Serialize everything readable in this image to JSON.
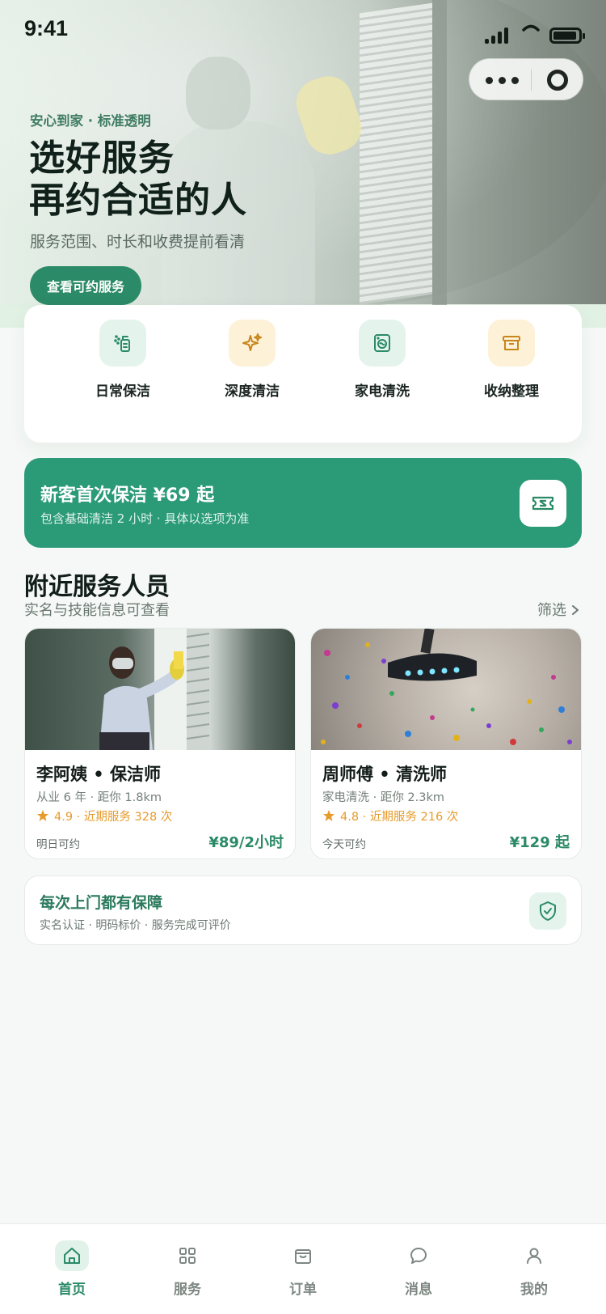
{
  "status_bar": {
    "time": "9:41"
  },
  "hero": {
    "tagline": "安心到家 · 标准透明",
    "title_line1": "选好服务",
    "title_line2": "再约合适的人",
    "subtitle": "服务范围、时长和收费提前看清",
    "cta_label": "查看可约服务"
  },
  "categories": [
    {
      "label": "日常保洁",
      "icon": "spray-bottle-icon"
    },
    {
      "label": "深度清洁",
      "icon": "sparkle-icon"
    },
    {
      "label": "家电清洗",
      "icon": "washing-machine-icon"
    },
    {
      "label": "收纳整理",
      "icon": "archive-box-icon"
    }
  ],
  "promo": {
    "title": "新客首次保洁 ¥69 起",
    "subtitle": "包含基础清洁 2 小时 · 具体以选项为准",
    "icon": "coupon-icon"
  },
  "nearby": {
    "title": "附近服务人员",
    "subtitle": "实名与技能信息可查看",
    "filter_label": "筛选",
    "workers": [
      {
        "name": "李阿姨 • 保洁师",
        "meta": "从业 6 年 · 距你 1.8km",
        "rating": "4.9 · 近期服务 328 次",
        "availability": "明日可约",
        "price": "¥89/2小时"
      },
      {
        "name": "周师傅 • 清洗师",
        "meta": "家电清洗 · 距你 2.3km",
        "rating": "4.8 · 近期服务 216 次",
        "availability": "今天可约",
        "price": "¥129 起"
      }
    ]
  },
  "guarantee": {
    "title": "每次上门都有保障",
    "subtitle": "实名认证 · 明码标价 · 服务完成可评价",
    "icon": "shield-check-icon"
  },
  "tabbar": [
    {
      "label": "首页",
      "icon": "home-icon",
      "active": true
    },
    {
      "label": "服务",
      "icon": "grid-icon",
      "active": false
    },
    {
      "label": "订单",
      "icon": "bag-icon",
      "active": false
    },
    {
      "label": "消息",
      "icon": "chat-icon",
      "active": false
    },
    {
      "label": "我的",
      "icon": "user-icon",
      "active": false
    }
  ],
  "colors": {
    "primary": "#2b8a67",
    "promo_bg": "#2b9a77",
    "hero_bg": "#e1f1e3",
    "rating": "#e79b2c",
    "page_bg": "#f5f8f6"
  }
}
